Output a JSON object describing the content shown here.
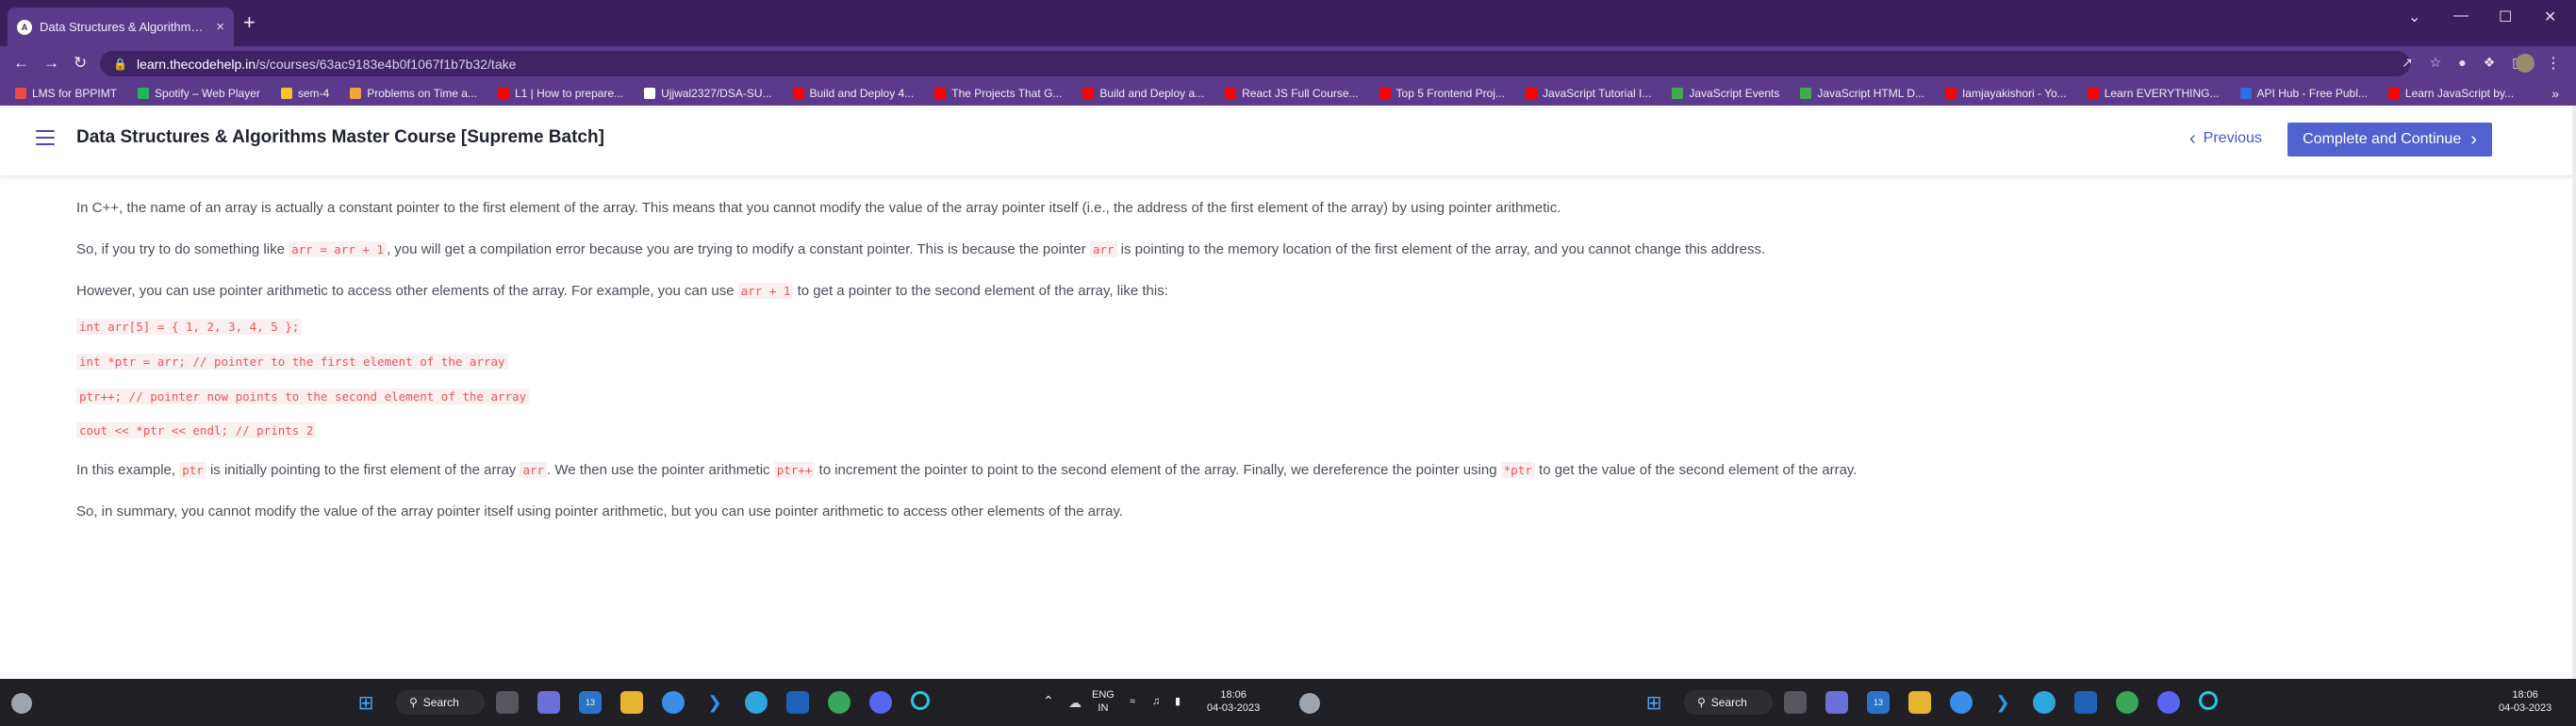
{
  "browser": {
    "tab_title": "Data Structures & Algorithms M",
    "tab_close": "×",
    "new_tab": "+",
    "url_host": "learn.thecodehelp.in",
    "url_path": "/s/courses/63ac9183e4b0f1067f1b7b32/take",
    "controls": {
      "minimize": "—",
      "maximize": "☐",
      "close": "✕",
      "chevron": "⌄"
    },
    "nav": {
      "back": "←",
      "forward": "→",
      "reload": "↻"
    },
    "bookmarks": [
      {
        "label": "LMS for BPPIMT",
        "color": "#e94b4b"
      },
      {
        "label": "Spotify – Web Player",
        "color": "#1db954"
      },
      {
        "label": "sem-4",
        "color": "#f4c430"
      },
      {
        "label": "Problems on Time a...",
        "color": "#f2a33a"
      },
      {
        "label": "L1 | How to prepare...",
        "color": "#ff0000"
      },
      {
        "label": "Ujjwal2327/DSA-SU...",
        "color": "#ffffff"
      },
      {
        "label": "Build and Deploy 4...",
        "color": "#ff0000"
      },
      {
        "label": "The Projects That G...",
        "color": "#ff0000"
      },
      {
        "label": "Build and Deploy a...",
        "color": "#ff0000"
      },
      {
        "label": "React JS Full Course...",
        "color": "#ff0000"
      },
      {
        "label": "Top 5 Frontend Proj...",
        "color": "#ff0000"
      },
      {
        "label": "JavaScript Tutorial I...",
        "color": "#ff0000"
      },
      {
        "label": "JavaScript Events",
        "color": "#3fae49"
      },
      {
        "label": "JavaScript HTML D...",
        "color": "#3fae49"
      },
      {
        "label": "Iamjayakishori - Yo...",
        "color": "#ff0000"
      },
      {
        "label": "Learn EVERYTHING...",
        "color": "#ff0000"
      },
      {
        "label": "API Hub - Free Publ...",
        "color": "#2f6ee5"
      },
      {
        "label": "Learn JavaScript by...",
        "color": "#ff0000"
      }
    ],
    "bookmarks_more": "»"
  },
  "app": {
    "course_title": "Data Structures & Algorithms Master Course [Supreme Batch]",
    "previous_label": "Previous",
    "previous_icon": "‹",
    "next_label": "Complete and Continue",
    "next_icon": "›"
  },
  "lesson": {
    "p1": "In C++, the name of an array is actually a constant pointer to the first element of the array. This means that you cannot modify the value of the array pointer itself (i.e., the address of the first element of the array) by using pointer arithmetic.",
    "p2_a": "So, if you try to do something like ",
    "p2_code1": "arr = arr + 1",
    "p2_b": ", you will get a compilation error because you are trying to modify a constant pointer. This is because the pointer ",
    "p2_code2": "arr",
    "p2_c": " is pointing to the memory location of the first element of the array, and you cannot change this address.",
    "p3_a": "However, you can use pointer arithmetic to access other elements of the array. For example, you can use ",
    "p3_code": "arr + 1",
    "p3_b": " to get a pointer to the second element of the array, like this:",
    "code_lines": [
      "int arr[5] = { 1, 2, 3, 4, 5 };",
      "int *ptr = arr; // pointer to the first element of the array",
      "ptr++; // pointer now points to the second element of the array",
      "cout << *ptr << endl; // prints 2"
    ],
    "p4_a": "In this example, ",
    "p4_code1": "ptr",
    "p4_b": " is initially pointing to the first element of the array ",
    "p4_code2": "arr",
    "p4_c": ". We then use the pointer arithmetic ",
    "p4_code3": "ptr++",
    "p4_d": " to increment the pointer to point to the second element of the array. Finally, we dereference the pointer using ",
    "p4_code4": "*ptr",
    "p4_e": " to get the value of the second element of the array.",
    "p5": "So, in summary, you cannot modify the value of the array pointer itself using pointer arithmetic, but you can use pointer arithmetic to access other elements of the array."
  },
  "taskbar": {
    "search_label": "Search",
    "lang_line1": "ENG",
    "lang_line2": "IN",
    "time": "18:06",
    "date": "04-03-2023",
    "badge_teams": "13"
  }
}
